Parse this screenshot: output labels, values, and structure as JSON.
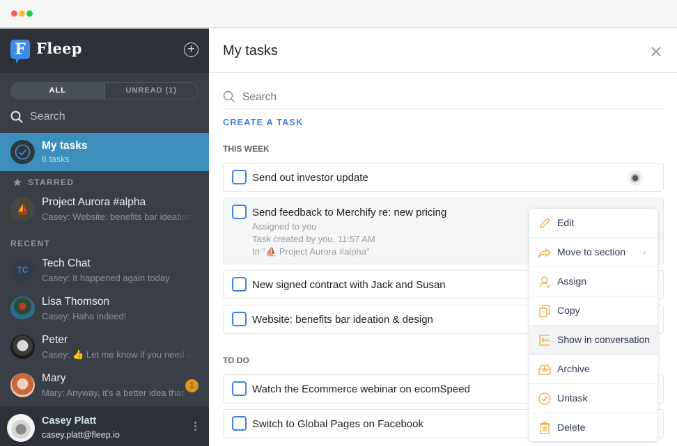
{
  "window": {
    "controls": [
      "close",
      "minimize",
      "maximize"
    ]
  },
  "sidebar": {
    "brand": "Fleep",
    "brand_logo_letter": "F",
    "add_icon": "plus-circle-icon",
    "filters": {
      "all_label": "ALL",
      "unread_label": "UNREAD (1)",
      "selected": "ALL"
    },
    "search_placeholder": "Search",
    "my_tasks": {
      "title": "My tasks",
      "subtitle": "6 tasks",
      "icon": "check-circle-icon"
    },
    "starred_label": "STARRED",
    "starred": [
      {
        "name": "Project Aurora #alpha",
        "preview": "Casey: Website: benefits bar ideation & design",
        "avatar": "sailboat-emoji"
      }
    ],
    "recent_label": "RECENT",
    "recent": [
      {
        "name": "Tech Chat",
        "preview": "Casey: It happened again today",
        "avatar_initials": "TC"
      },
      {
        "name": "Lisa Thomson",
        "preview": "Casey: Haha indeed!",
        "avatar": "photo"
      },
      {
        "name": "Peter",
        "preview": "Casey: 👍 Let me know if you need any help",
        "avatar": "photo"
      },
      {
        "name": "Mary",
        "preview": "Mary: Anyway, it's a better idea that",
        "avatar": "photo",
        "unread": "1"
      }
    ],
    "user": {
      "name": "Casey Platt",
      "email": "casey.platt@fleep.io",
      "menu_icon": "kebab-icon"
    }
  },
  "main": {
    "title": "My tasks",
    "search_placeholder": "Search",
    "create_label": "CREATE A TASK",
    "groups": [
      {
        "label": "THIS WEEK",
        "tasks": [
          {
            "title": "Send out investor update",
            "has_assignee_avatar": true
          },
          {
            "title": "Send feedback to Merchify re: new pricing",
            "assigned": "Assigned to you",
            "created": "Task created by you, 11:57 AM",
            "location": "In \"⛵ Project Aurora #alpha\""
          },
          {
            "title": "New signed contract with Jack and Susan"
          },
          {
            "title": "Website: benefits bar ideation & design"
          }
        ]
      },
      {
        "label": "TO DO",
        "tasks": [
          {
            "title": "Watch the Ecommerce webinar on ecomSpeed"
          },
          {
            "title": "Switch to Global Pages on Facebook"
          }
        ]
      }
    ]
  },
  "context_menu": {
    "accent_color": "#f0a830",
    "highlighted": "Show in conversation",
    "items": [
      {
        "label": "Edit",
        "icon": "pencil-icon"
      },
      {
        "label": "Move to section",
        "icon": "share-arrow-icon",
        "submenu": true
      },
      {
        "label": "Assign",
        "icon": "user-icon"
      },
      {
        "label": "Copy",
        "icon": "copy-icon"
      },
      {
        "label": "Show in conversation",
        "icon": "show-in-conversation-icon"
      },
      {
        "label": "Archive",
        "icon": "archive-icon"
      },
      {
        "label": "Untask",
        "icon": "untask-icon"
      },
      {
        "label": "Delete",
        "icon": "trash-icon"
      }
    ]
  }
}
